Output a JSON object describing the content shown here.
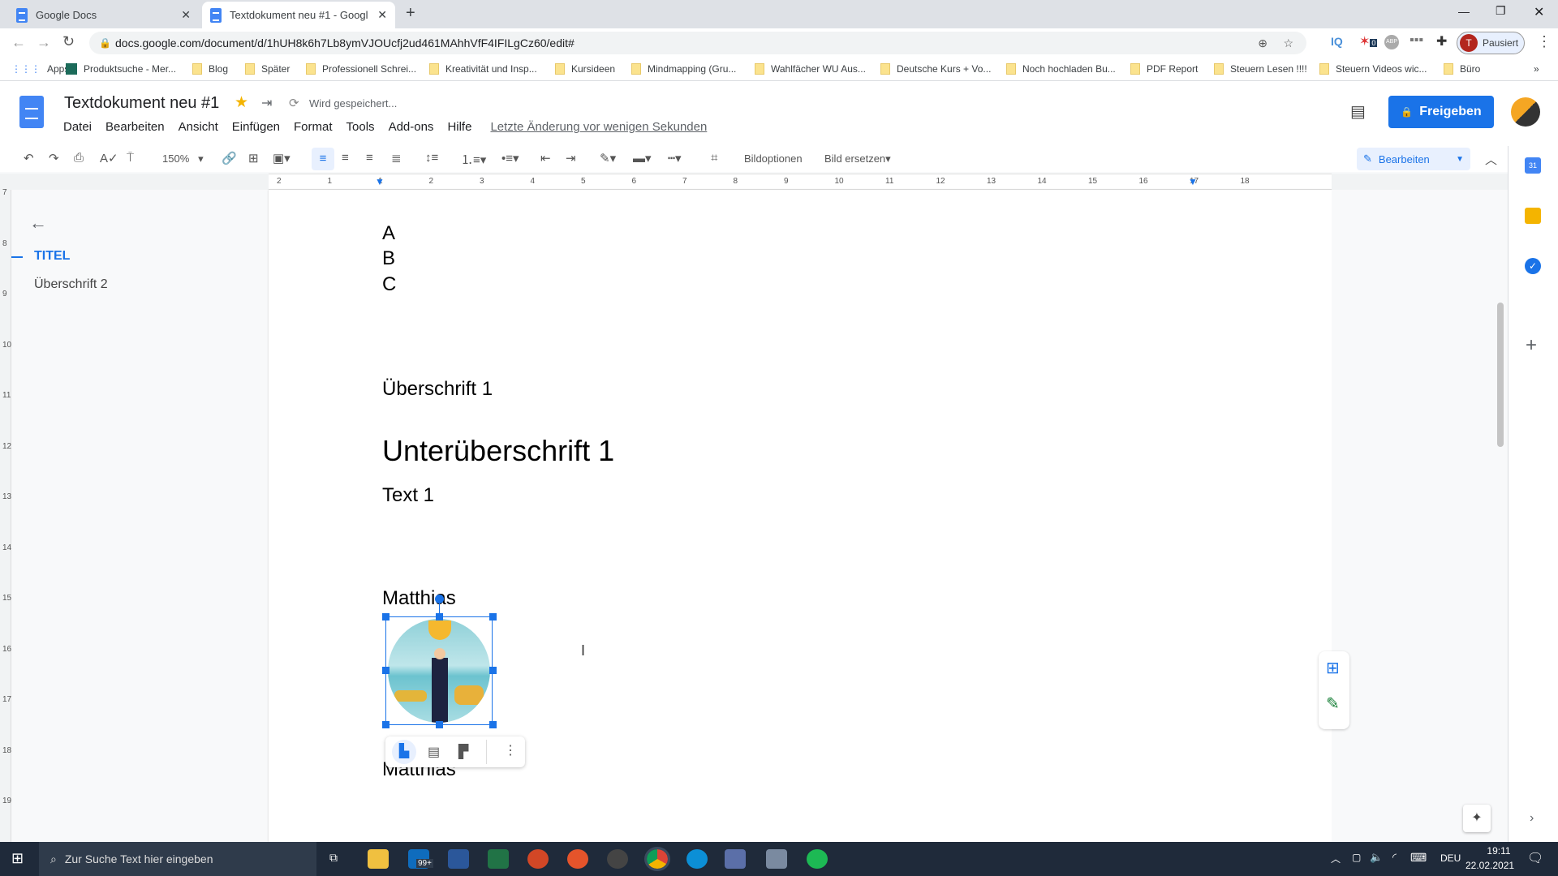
{
  "browser": {
    "tabs": [
      {
        "label": "Google Docs",
        "active": false
      },
      {
        "label": "Textdokument neu #1 - Google D",
        "active": true
      }
    ],
    "url": "docs.google.com/document/d/1hUH8k6h7Lb8ymVJOUcfj2ud461MAhhVfF4IFILgCz60/edit#",
    "profile": {
      "initial": "T",
      "status": "Pausiert"
    },
    "extension_badge": "0",
    "bookmarks": [
      "Apps",
      "Produktsuche - Mer...",
      "Blog",
      "Später",
      "Professionell Schrei...",
      "Kreativität und Insp...",
      "Kursideen",
      "Mindmapping  (Gru...",
      "Wahlfächer WU Aus...",
      "Deutsche Kurs + Vo...",
      "Noch hochladen Bu...",
      "PDF Report",
      "Steuern Lesen !!!!",
      "Steuern Videos wic...",
      "Büro"
    ],
    "bookmarks_more": "»"
  },
  "docs": {
    "title": "Textdokument neu #1",
    "save_status": "Wird gespeichert...",
    "menu": [
      "Datei",
      "Bearbeiten",
      "Ansicht",
      "Einfügen",
      "Format",
      "Tools",
      "Add-ons",
      "Hilfe"
    ],
    "last_edit": "Letzte Änderung vor wenigen Sekunden",
    "share_label": "Freigeben",
    "accent": "#1a73e8"
  },
  "toolbar": {
    "zoom": "150%",
    "image_options": "Bildoptionen",
    "replace_image": "Bild ersetzen",
    "mode": "Bearbeiten"
  },
  "ruler": {
    "ticks": [
      "2",
      "1",
      "1",
      "2",
      "3",
      "4",
      "5",
      "6",
      "7",
      "8",
      "9",
      "10",
      "11",
      "12",
      "13",
      "14",
      "15",
      "16",
      "17",
      "18"
    ]
  },
  "vertical_ruler": [
    "7",
    "8",
    "9",
    "10",
    "11",
    "12",
    "13",
    "14",
    "15",
    "16",
    "17",
    "18",
    "19"
  ],
  "outline": {
    "items": [
      {
        "label": "TITEL",
        "active": true
      },
      {
        "label": "Überschrift 2",
        "active": false
      }
    ]
  },
  "document": {
    "lines": [
      "A",
      "B",
      "C"
    ],
    "heading1": "Überschrift 1",
    "subheading": "Unterüberschrift 1",
    "text1": "Text 1",
    "name1": "Matthias",
    "name2": "Matthias"
  },
  "taskbar": {
    "search_placeholder": "Zur Suche Text hier eingeben",
    "mail_badge": "99+",
    "language": "DEU",
    "time": "19:11",
    "date": "22.02.2021"
  }
}
